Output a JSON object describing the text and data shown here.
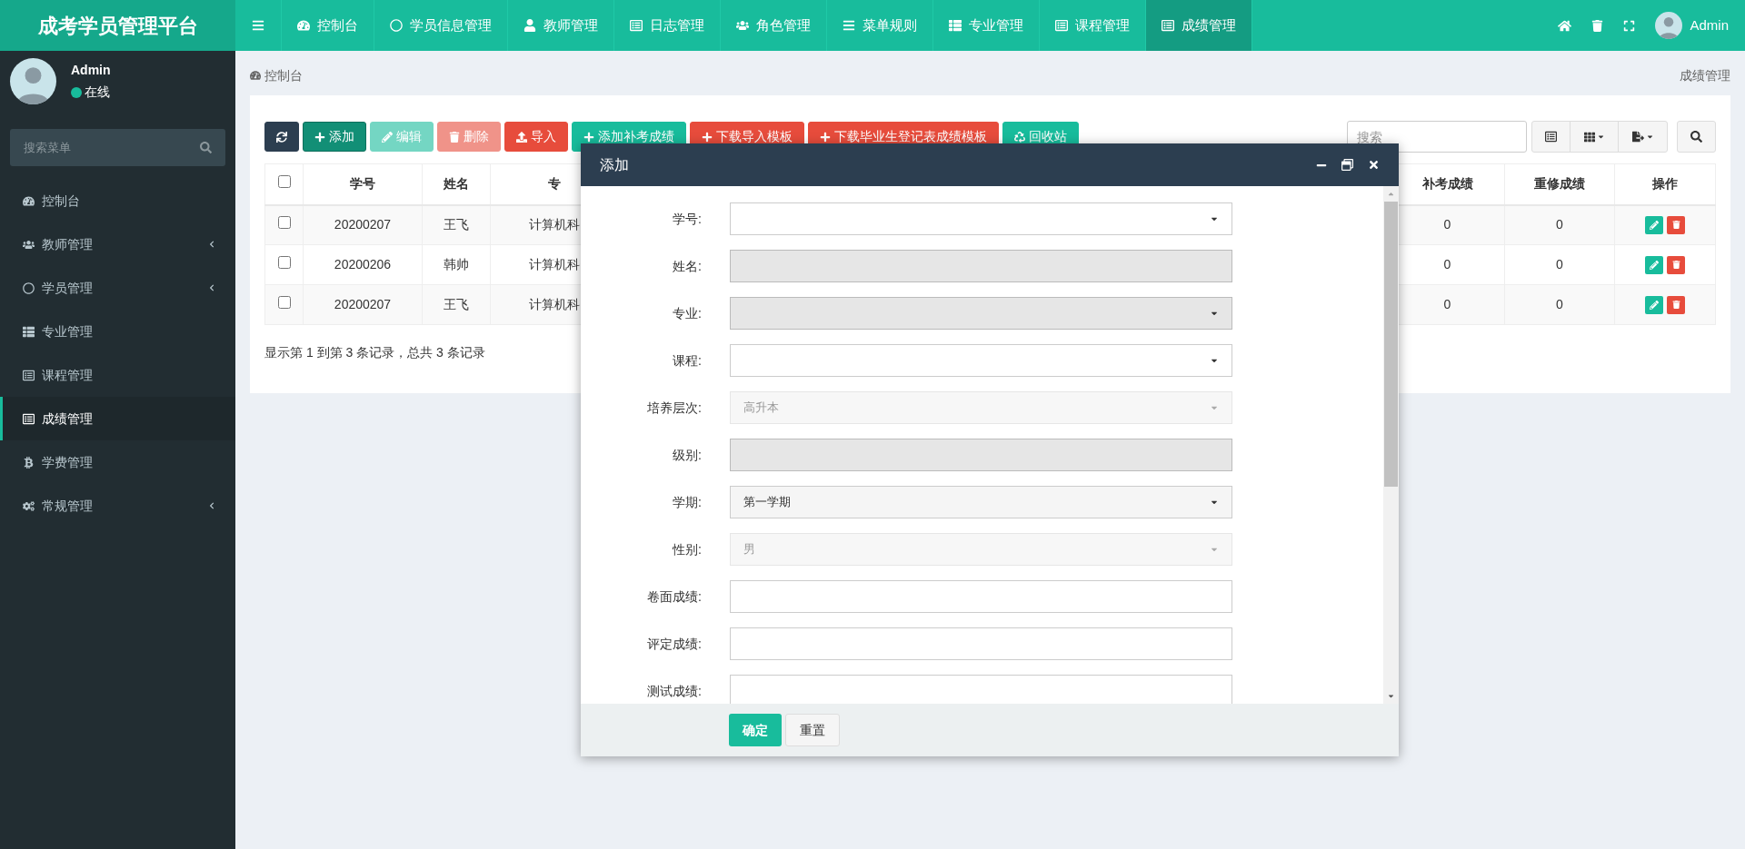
{
  "brand": "成考学员管理平台",
  "top_nav": [
    {
      "selected": false
    },
    {
      "label": "控制台",
      "selected": false
    },
    {
      "label": "学员信息管理",
      "selected": false
    },
    {
      "label": "教师管理",
      "selected": false
    },
    {
      "label": "日志管理",
      "selected": false
    },
    {
      "label": "角色管理",
      "selected": false
    },
    {
      "label": "菜单规则",
      "selected": false
    },
    {
      "label": "专业管理",
      "selected": false
    },
    {
      "label": "课程管理",
      "selected": false
    },
    {
      "label": "成绩管理",
      "selected": true
    }
  ],
  "top_user": "Admin",
  "sidebar": {
    "user": "Admin",
    "status": "在线",
    "search_placeholder": "搜索菜单",
    "items": [
      {
        "label": "控制台",
        "selected": false,
        "expandable": false
      },
      {
        "label": "教师管理",
        "selected": false,
        "expandable": true
      },
      {
        "label": "学员管理",
        "selected": false,
        "expandable": true
      },
      {
        "label": "专业管理",
        "selected": false,
        "expandable": false
      },
      {
        "label": "课程管理",
        "selected": false,
        "expandable": false
      },
      {
        "label": "成绩管理",
        "selected": true,
        "expandable": false
      },
      {
        "label": "学费管理",
        "selected": false,
        "expandable": false
      },
      {
        "label": "常规管理",
        "selected": false,
        "expandable": true
      }
    ]
  },
  "breadcrumb": "控制台",
  "page_title": "成绩管理",
  "toolbar": [
    {
      "kind": "dark",
      "disabled": false
    },
    {
      "label": "添加",
      "kind": "primary",
      "disabled": false
    },
    {
      "label": "编辑",
      "kind": "success",
      "disabled": true
    },
    {
      "label": "删除",
      "kind": "danger",
      "disabled": true
    },
    {
      "label": "导入",
      "kind": "danger",
      "disabled": false
    },
    {
      "label": "添加补考成绩",
      "kind": "success",
      "disabled": false
    },
    {
      "label": "下载导入模板",
      "kind": "danger",
      "disabled": false
    },
    {
      "label": "下载毕业生登记表成绩模板",
      "kind": "danger",
      "disabled": false
    },
    {
      "label": "回收站",
      "kind": "success",
      "disabled": false
    }
  ],
  "table_search_placeholder": "搜索",
  "table": {
    "header_checked": false,
    "columns": [
      "学号",
      "姓名",
      "专"
    ],
    "right_columns": [
      "补考成绩",
      "重修成绩",
      "操作"
    ],
    "rows": [
      {
        "checked": false,
        "id": "20200207",
        "name": "王飞",
        "major": "计算机科",
        "makeup": "0",
        "retake": "0"
      },
      {
        "checked": false,
        "id": "20200206",
        "name": "韩帅",
        "major": "计算机科",
        "makeup": "0",
        "retake": "0"
      },
      {
        "checked": false,
        "id": "20200207",
        "name": "王飞",
        "major": "计算机科",
        "makeup": "0",
        "retake": "0"
      }
    ]
  },
  "pagination": "显示第 1 到第 3 条记录，总共 3 条记录",
  "modal": {
    "title": "添加",
    "fields": [
      {
        "label": "学号:",
        "kind": "select",
        "readonly": false,
        "disabled": false
      },
      {
        "label": "姓名:",
        "kind": "input",
        "readonly": true,
        "disabled": false
      },
      {
        "label": "专业:",
        "kind": "select",
        "readonly": true,
        "disabled": false
      },
      {
        "label": "课程:",
        "kind": "select",
        "readonly": false,
        "disabled": false
      },
      {
        "label": "培养层次:",
        "kind": "select",
        "value": "高升本",
        "readonly": false,
        "disabled": true
      },
      {
        "label": "级别:",
        "kind": "input",
        "readonly": true,
        "disabled": false
      },
      {
        "label": "学期:",
        "kind": "select",
        "value": "第一学期",
        "readonly": false,
        "disabled": false
      },
      {
        "label": "性别:",
        "kind": "select",
        "value": "男",
        "readonly": false,
        "disabled": true
      },
      {
        "label": "卷面成绩:",
        "kind": "input",
        "readonly": false,
        "disabled": false
      },
      {
        "label": "评定成绩:",
        "kind": "input",
        "readonly": false,
        "disabled": false
      },
      {
        "label": "测试成绩:",
        "kind": "input",
        "readonly": false,
        "disabled": false
      }
    ],
    "buttons": [
      {
        "label": "确定",
        "kind": "primary"
      },
      {
        "label": "重置",
        "kind": "default"
      }
    ]
  }
}
